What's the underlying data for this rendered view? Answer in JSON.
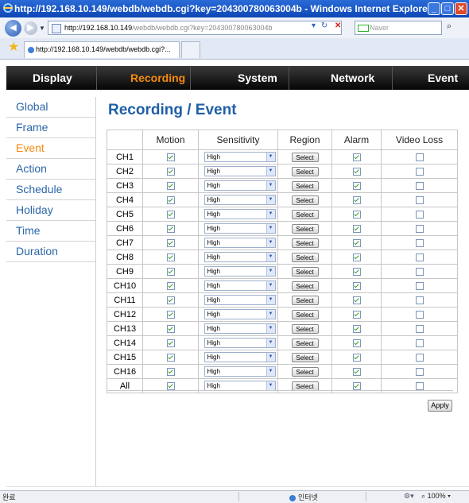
{
  "window": {
    "title": "http://192.168.10.149/webdb/webdb.cgi?key=204300780063004b - Windows Internet Explorer"
  },
  "browser": {
    "address_host": "http://192.168.10.149",
    "address_path": "/webdb/webdb.cgi?key=204300780063004b",
    "search_placeholder": "Naver",
    "tab_title": "http://192.168.10.149/webdb/webdb.cgi?..."
  },
  "menu": {
    "items": [
      "Display",
      "Recording",
      "System",
      "Network",
      "Event"
    ],
    "active": "Recording"
  },
  "sidebar": {
    "items": [
      "Global",
      "Frame",
      "Event",
      "Action",
      "Schedule",
      "Holiday",
      "Time",
      "Duration"
    ],
    "active": "Event"
  },
  "page": {
    "title": "Recording / Event"
  },
  "table": {
    "headers": [
      "",
      "Motion",
      "Sensitivity",
      "Region",
      "Alarm",
      "Video Loss"
    ],
    "select_label": "Select",
    "rows": [
      {
        "ch": "CH1",
        "motion": true,
        "sensitivity": "High",
        "alarm": true,
        "video_loss": false
      },
      {
        "ch": "CH2",
        "motion": true,
        "sensitivity": "High",
        "alarm": true,
        "video_loss": false
      },
      {
        "ch": "CH3",
        "motion": true,
        "sensitivity": "High",
        "alarm": true,
        "video_loss": false
      },
      {
        "ch": "CH4",
        "motion": true,
        "sensitivity": "High",
        "alarm": true,
        "video_loss": false
      },
      {
        "ch": "CH5",
        "motion": true,
        "sensitivity": "High",
        "alarm": true,
        "video_loss": false
      },
      {
        "ch": "CH6",
        "motion": true,
        "sensitivity": "High",
        "alarm": true,
        "video_loss": false
      },
      {
        "ch": "CH7",
        "motion": true,
        "sensitivity": "High",
        "alarm": true,
        "video_loss": false
      },
      {
        "ch": "CH8",
        "motion": true,
        "sensitivity": "High",
        "alarm": true,
        "video_loss": false
      },
      {
        "ch": "CH9",
        "motion": true,
        "sensitivity": "High",
        "alarm": true,
        "video_loss": false
      },
      {
        "ch": "CH10",
        "motion": true,
        "sensitivity": "High",
        "alarm": true,
        "video_loss": false
      },
      {
        "ch": "CH11",
        "motion": true,
        "sensitivity": "High",
        "alarm": true,
        "video_loss": false
      },
      {
        "ch": "CH12",
        "motion": true,
        "sensitivity": "High",
        "alarm": true,
        "video_loss": false
      },
      {
        "ch": "CH13",
        "motion": true,
        "sensitivity": "High",
        "alarm": true,
        "video_loss": false
      },
      {
        "ch": "CH14",
        "motion": true,
        "sensitivity": "High",
        "alarm": true,
        "video_loss": false
      },
      {
        "ch": "CH15",
        "motion": true,
        "sensitivity": "High",
        "alarm": true,
        "video_loss": false
      },
      {
        "ch": "CH16",
        "motion": true,
        "sensitivity": "High",
        "alarm": true,
        "video_loss": false
      },
      {
        "ch": "All",
        "motion": true,
        "sensitivity": "High",
        "alarm": true,
        "video_loss": false
      }
    ]
  },
  "apply_label": "Apply",
  "statusbar": {
    "status": "완료",
    "zone": "인터넷",
    "zoom": "100%"
  },
  "colors": {
    "accent": "#f58a0e",
    "link": "#2b67a8",
    "title": "#1f5fa8",
    "menubar": "#0a0a0a"
  }
}
